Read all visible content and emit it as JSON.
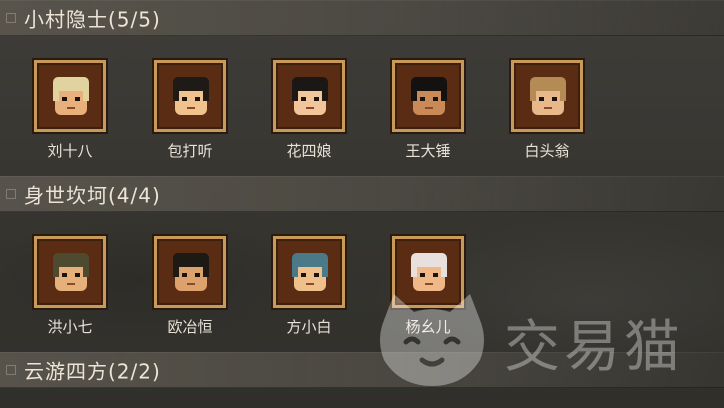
{
  "sections": [
    {
      "title": "小村隐士(5/5)",
      "characters": [
        {
          "name": "刘十八",
          "icon": "tiger-hat-portrait-icon",
          "hair": "#e0d3a0",
          "skin": "#e8b07a"
        },
        {
          "name": "包打听",
          "icon": "topknot-man-portrait-icon",
          "hair": "#1e1a16",
          "skin": "#f0c28e"
        },
        {
          "name": "花四娘",
          "icon": "woman-portrait-icon",
          "hair": "#1a1714",
          "skin": "#f2c69a"
        },
        {
          "name": "王大锤",
          "icon": "headband-man-portrait-icon",
          "hair": "#141210",
          "skin": "#c98a58"
        },
        {
          "name": "白头翁",
          "icon": "old-man-straw-hat-portrait-icon",
          "hair": "#b48a55",
          "skin": "#e8b88a"
        }
      ]
    },
    {
      "title": "身世坎坷(4/4)",
      "characters": [
        {
          "name": "洪小七",
          "icon": "beggar-hat-portrait-icon",
          "hair": "#4d4a30",
          "skin": "#e6b07a"
        },
        {
          "name": "欧冶恒",
          "icon": "blacksmith-portrait-icon",
          "hair": "#1d1915",
          "skin": "#dca16c"
        },
        {
          "name": "方小白",
          "icon": "blue-cap-portrait-icon",
          "hair": "#4a7a88",
          "skin": "#f0c08c"
        },
        {
          "name": "杨幺儿",
          "icon": "bandana-portrait-icon",
          "hair": "#e8e0dc",
          "skin": "#f0b888"
        }
      ]
    },
    {
      "title": "云游四方(2/2)",
      "characters": []
    }
  ],
  "watermark": {
    "text": "交易猫",
    "icon": "cat-logo-icon"
  },
  "colors": {
    "frame": "#c89a5a",
    "portrait_bg": "#5a2c14"
  }
}
